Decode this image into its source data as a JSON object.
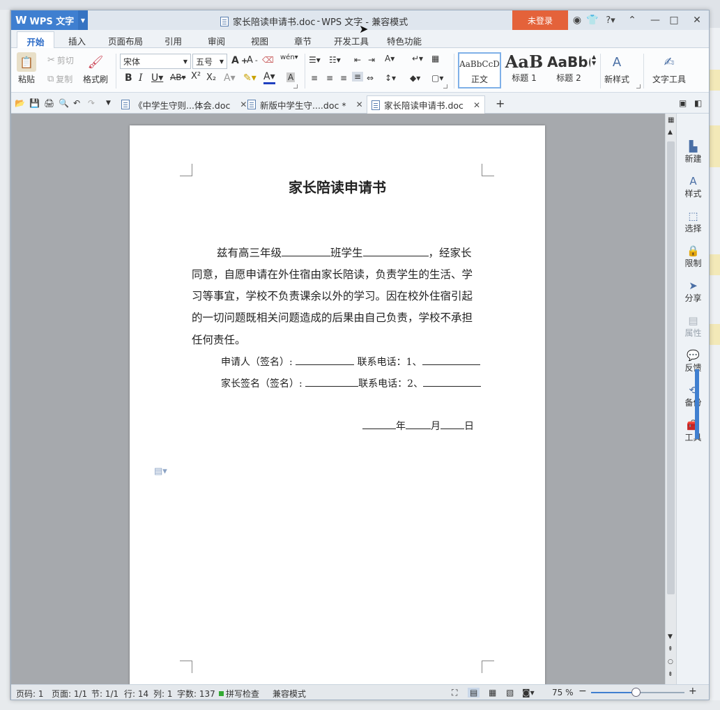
{
  "app": {
    "name": "WPS 文字",
    "title_doc": "家长陪读申请书.doc",
    "title_sep": " - ",
    "title_app": "WPS 文字 - 兼容模式",
    "login": "未登录"
  },
  "ribbon_tabs": [
    "开始",
    "插入",
    "页面布局",
    "引用",
    "审阅",
    "视图",
    "章节",
    "开发工具",
    "特色功能"
  ],
  "ribbon": {
    "paste": "粘贴",
    "cut": "剪切",
    "copy": "复制",
    "format_painter": "格式刷",
    "font_name": "宋体",
    "font_size": "五号",
    "styles": [
      {
        "preview": "AaBbCcD",
        "label": "正文"
      },
      {
        "preview": "AaB",
        "label": "标题 1"
      },
      {
        "preview": "AaBb(",
        "label": "标题 2"
      }
    ],
    "new_style": "新样式",
    "text_tools": "文字工具"
  },
  "doc_tabs": [
    {
      "label": "《中学生守则...体会.doc",
      "active": false
    },
    {
      "label": "新版中学生守....doc *",
      "active": false
    },
    {
      "label": "家长陪读申请书.doc",
      "active": true
    }
  ],
  "document": {
    "title": "家长陪读申请书",
    "para_lines": [
      "兹有高三年级",
      "班学生",
      "，经家长",
      "同意，自愿申请在外住宿由家长陪读，负责学生的生活、学",
      "习等事宜，学校不负责课余以外的学习。因在校外住宿引起",
      "的一切问题既相关问题造成的后果由自己负责，学校不承担",
      "任何责任。"
    ],
    "sign1_label": "申请人（签名）:",
    "sign1_phone": "联系电话：1、",
    "sign2_label": "家长签名（签名）:",
    "sign2_phone": "联系电话：2、",
    "date_year": "年",
    "date_month": "月",
    "date_day": "日"
  },
  "right_pane": [
    "新建",
    "样式",
    "选择",
    "限制",
    "分享",
    "属性",
    "反馈",
    "备份",
    "工具"
  ],
  "status": {
    "page_code": "页码: 1",
    "pages": "页面: 1/1",
    "section": "节: 1/1",
    "row": "行: 14",
    "col": "列: 1",
    "word_count": "字数: 137",
    "spell": "拼写检查",
    "compat": "兼容模式",
    "zoom": "75 %",
    "zoom_fraction": 0.48
  }
}
